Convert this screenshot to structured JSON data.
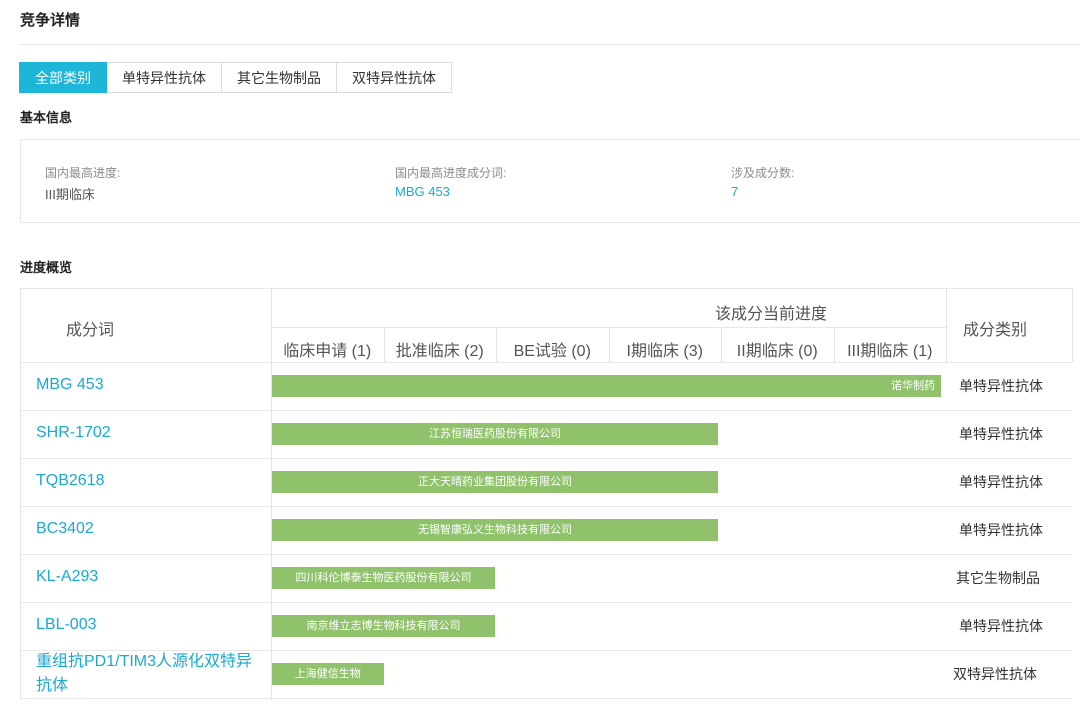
{
  "page": {
    "title": "竞争详情"
  },
  "tabs": [
    {
      "label": "全部类别",
      "active": true
    },
    {
      "label": "单特异性抗体",
      "active": false
    },
    {
      "label": "其它生物制品",
      "active": false
    },
    {
      "label": "双特异性抗体",
      "active": false
    }
  ],
  "basic_info": {
    "title": "基本信息",
    "highest_stage_label": "国内最高进度:",
    "highest_stage_value": "III期临床",
    "highest_ingredient_label": "国内最高进度成分词:",
    "highest_ingredient_value": "MBG 453",
    "ingredient_count_label": "涉及成分数:",
    "ingredient_count_value": "7"
  },
  "overview": {
    "title": "进度概览",
    "col_ingredient": "成分词",
    "col_progress": "该成分当前进度",
    "col_category": "成分类别",
    "stages": [
      "临床申请 (1)",
      "批准临床 (2)",
      "BE试验 (0)",
      "I期临床 (3)",
      "II期临床 (0)",
      "III期临床 (1)"
    ],
    "rows": [
      {
        "name": "MBG 453",
        "company": "诺华制药",
        "category": "单特异性抗体",
        "progress": 6
      },
      {
        "name": "SHR-1702",
        "company": "江苏恒瑞医药股份有限公司",
        "category": "单特异性抗体",
        "progress": 4
      },
      {
        "name": "TQB2618",
        "company": "正大天晴药业集团股份有限公司",
        "category": "单特异性抗体",
        "progress": 4
      },
      {
        "name": "BC3402",
        "company": "无锡智康弘义生物科技有限公司",
        "category": "单特异性抗体",
        "progress": 4
      },
      {
        "name": "KL-A293",
        "company": "四川科伦博泰生物医药股份有限公司",
        "category": "其它生物制品",
        "progress": 2
      },
      {
        "name": "LBL-003",
        "company": "南京维立志博生物科技有限公司",
        "category": "单特异性抗体",
        "progress": 2
      },
      {
        "name": "重组抗PD1/TIM3人源化双特异\n抗体",
        "company": "上海健信生物",
        "category": "双特异性抗体",
        "progress": 1
      }
    ]
  }
}
